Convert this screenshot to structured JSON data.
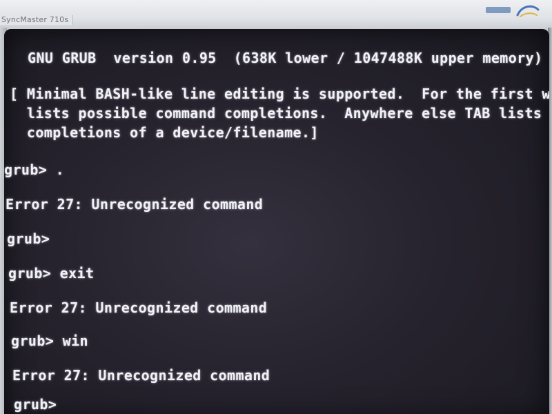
{
  "monitor": {
    "brand_label": "SyncMaster 710s"
  },
  "terminal": {
    "lines": [
      "GNU GRUB  version 0.95  (638K lower / 1047488K upper memory)",
      "[ Minimal BASH-like line editing is supported.  For the first word, TAB",
      "  lists possible command completions.  Anywhere else TAB lists the possible",
      "  completions of a device/filename.]",
      "grub> .",
      "Error 27: Unrecognized command",
      "grub>",
      "grub> exit",
      "Error 27: Unrecognized command",
      "grub> win",
      "Error 27: Unrecognized command",
      "grub>"
    ]
  },
  "colors": {
    "screen_background": "#26232e",
    "terminal_text": "#f2f1f6",
    "bezel": "#dfe2e6"
  }
}
